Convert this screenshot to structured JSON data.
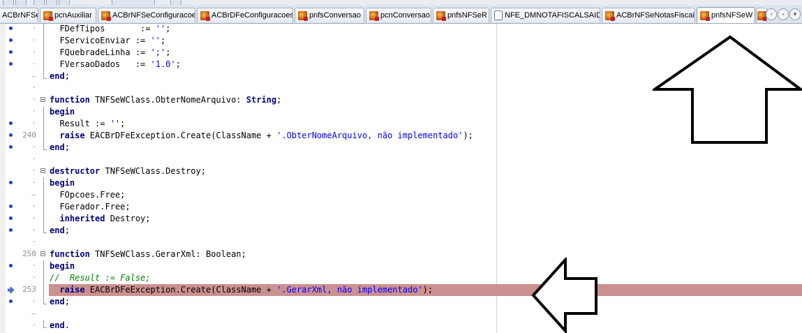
{
  "tabs": [
    {
      "label": "ACBrNFSe",
      "icon": "component-icon"
    },
    {
      "label": "pcnAuxiliar",
      "icon": "component-icon"
    },
    {
      "label": "ACBrNFSeConfiguracoes",
      "icon": "component-icon"
    },
    {
      "label": "ACBrDFeConfiguracoes",
      "icon": "component-icon"
    },
    {
      "label": "pnfsConversao",
      "icon": "component-icon"
    },
    {
      "label": "pcnConversao",
      "icon": "component-icon"
    },
    {
      "label": "pnfsNFSeR",
      "icon": "component-icon"
    },
    {
      "label": "NFE_DMNOTAFISCALSAIDA",
      "icon": "document-icon"
    },
    {
      "label": "ACBrNFSeNotasFiscais",
      "icon": "component-icon"
    },
    {
      "label": "pnfsNFSeW",
      "icon": "component-icon",
      "active": true
    }
  ],
  "tab_nav": {
    "prev": "‹",
    "next": "›",
    "menu": "▾"
  },
  "code_lines": [
    {
      "gutter": "·",
      "bp": true,
      "guide": "bar",
      "tokens": [
        {
          "t": "  FDefTipos       := "
        },
        {
          "t": "''",
          "c": "str"
        },
        {
          "t": ";"
        }
      ]
    },
    {
      "gutter": "·",
      "bp": true,
      "guide": "bar",
      "tokens": [
        {
          "t": "  FServicoEnviar := "
        },
        {
          "t": "''",
          "c": "str"
        },
        {
          "t": ";"
        }
      ]
    },
    {
      "gutter": "·",
      "bp": true,
      "guide": "bar",
      "tokens": [
        {
          "t": "  FQuebradeLinha := "
        },
        {
          "t": "';'",
          "c": "str"
        },
        {
          "t": ";"
        }
      ]
    },
    {
      "gutter": "·",
      "bp": true,
      "guide": "bar",
      "tokens": [
        {
          "t": "  FVersaoDados   := "
        },
        {
          "t": "'1.0'",
          "c": "str"
        },
        {
          "t": ";"
        }
      ]
    },
    {
      "gutter": "–",
      "bp": false,
      "guide": "end",
      "tokens": [
        {
          "t": "end",
          "c": "kw"
        },
        {
          "t": ";"
        }
      ]
    },
    {
      "gutter": "·",
      "bp": false,
      "guide": "none",
      "tokens": []
    },
    {
      "gutter": "·",
      "bp": false,
      "guide": "fold",
      "tokens": [
        {
          "t": "function",
          "c": "kw"
        },
        {
          "t": " TNFSeWClass.ObterNomeArquivo: "
        },
        {
          "t": "String",
          "c": "kw"
        },
        {
          "t": ";"
        }
      ]
    },
    {
      "gutter": "·",
      "bp": false,
      "guide": "bar",
      "tokens": [
        {
          "t": "begin",
          "c": "kw"
        }
      ]
    },
    {
      "gutter": "·",
      "bp": true,
      "guide": "bar",
      "tokens": [
        {
          "t": "  Result := "
        },
        {
          "t": "''",
          "c": "str"
        },
        {
          "t": ";"
        }
      ]
    },
    {
      "gutter": "240",
      "bp": true,
      "guide": "bar",
      "tokens": [
        {
          "t": "  "
        },
        {
          "t": "raise",
          "c": "kw"
        },
        {
          "t": " EACBrDFeException.Create(ClassName + "
        },
        {
          "t": "'.ObterNomeArquivo, não implementado'",
          "c": "str"
        },
        {
          "t": ");"
        }
      ]
    },
    {
      "gutter": "·",
      "bp": true,
      "guide": "end",
      "tokens": [
        {
          "t": "end",
          "c": "kw"
        },
        {
          "t": ";"
        }
      ]
    },
    {
      "gutter": "·",
      "bp": false,
      "guide": "none",
      "tokens": []
    },
    {
      "gutter": "·",
      "bp": false,
      "guide": "fold",
      "tokens": [
        {
          "t": "destructor",
          "c": "kw"
        },
        {
          "t": " TNFSeWClass.Destroy;"
        }
      ]
    },
    {
      "gutter": "·",
      "bp": true,
      "guide": "bar",
      "tokens": [
        {
          "t": "begin",
          "c": "kw"
        }
      ]
    },
    {
      "gutter": "–",
      "bp": false,
      "guide": "bar",
      "tokens": [
        {
          "t": "  FOpcoes.Free;"
        }
      ]
    },
    {
      "gutter": "·",
      "bp": true,
      "guide": "bar",
      "tokens": [
        {
          "t": "  FGerador.Free;"
        }
      ]
    },
    {
      "gutter": "·",
      "bp": true,
      "guide": "bar",
      "tokens": [
        {
          "t": "  "
        },
        {
          "t": "inherited",
          "c": "kw"
        },
        {
          "t": " Destroy;"
        }
      ]
    },
    {
      "gutter": "·",
      "bp": true,
      "guide": "end",
      "tokens": [
        {
          "t": "end",
          "c": "kw"
        },
        {
          "t": ";"
        }
      ]
    },
    {
      "gutter": "·",
      "bp": false,
      "guide": "none",
      "tokens": []
    },
    {
      "gutter": "250",
      "bp": false,
      "guide": "fold",
      "tokens": [
        {
          "t": "function",
          "c": "kw"
        },
        {
          "t": " TNFSeWClass.GerarXml: Boolean;"
        }
      ]
    },
    {
      "gutter": "·",
      "bp": true,
      "guide": "bar",
      "tokens": [
        {
          "t": "begin",
          "c": "kw"
        }
      ]
    },
    {
      "gutter": "·",
      "bp": false,
      "guide": "bar",
      "tokens": [
        {
          "t": "//  Result := False;",
          "c": "cmt"
        }
      ]
    },
    {
      "gutter": "253",
      "bp": false,
      "exec": true,
      "highlight": true,
      "guide": "bar",
      "tokens": [
        {
          "t": "  "
        },
        {
          "t": "raise",
          "c": "kw"
        },
        {
          "t": " EACBrDFeException.Create(ClassName + "
        },
        {
          "t": "'.GerarXml, não implementado'",
          "c": "str"
        },
        {
          "t": ");"
        }
      ]
    },
    {
      "gutter": "·",
      "bp": true,
      "guide": "end",
      "tokens": [
        {
          "t": "end",
          "c": "kw"
        },
        {
          "t": ";"
        }
      ]
    },
    {
      "gutter": "–",
      "bp": false,
      "guide": "none",
      "tokens": []
    },
    {
      "gutter": "·",
      "bp": false,
      "guide": "end",
      "tokens": [
        {
          "t": "end",
          "c": "kw"
        },
        {
          "t": "."
        }
      ]
    }
  ],
  "colors": {
    "breakpoint": "#1c3fd9",
    "highlight_line": "#cb9090",
    "keyword": "#000080",
    "string": "#0000ff",
    "comment": "#008000"
  },
  "annotations": [
    {
      "name": "arrow-up-annotation",
      "direction": "up"
    },
    {
      "name": "arrow-left-annotation",
      "direction": "left"
    }
  ]
}
